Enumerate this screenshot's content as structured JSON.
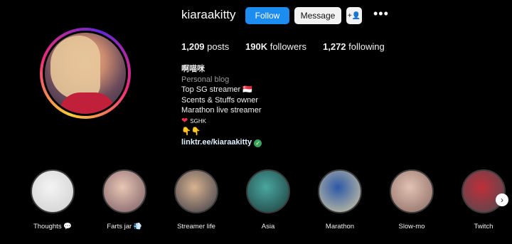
{
  "profile": {
    "username": "kiaraakitty",
    "follow_label": "Follow",
    "message_label": "Message",
    "add_user_glyph": "+👤",
    "more_glyph": "•••",
    "stats": {
      "posts_count": "1,209",
      "posts_label": "posts",
      "followers_count": "190K",
      "followers_label": "followers",
      "following_count": "1,272",
      "following_label": "following"
    },
    "bio": {
      "name": "啊喵咪",
      "category": "Personal blog",
      "line1": "Top SG streamer 🇸🇬",
      "line2": "Scents & Stuffs owner",
      "line3": "Marathon live streamer",
      "line4_emoji": "❤",
      "line4_text": "SGHK",
      "line5": "👇👇",
      "link": "linktr.ee/kiaraakitty"
    }
  },
  "highlights": [
    {
      "label": "Thoughts 💬",
      "color_a": "#f4f4f4",
      "color_b": "#cfcfcf"
    },
    {
      "label": "Farts jar 💨",
      "color_a": "#e8c7b4",
      "color_b": "#7a5b64"
    },
    {
      "label": "Streamer life",
      "color_a": "#d9b38f",
      "color_b": "#3a3a48"
    },
    {
      "label": "Asia",
      "color_a": "#4aa7a0",
      "color_b": "#1c3b3a"
    },
    {
      "label": "Marathon",
      "color_a": "#2c58a8",
      "color_b": "#d6cca2"
    },
    {
      "label": "Slow-mo",
      "color_a": "#e2c2b3",
      "color_b": "#8a6a60"
    },
    {
      "label": "Twitch",
      "color_a": "#bf2f3a",
      "color_b": "#4a4a50"
    }
  ],
  "next_arrow_glyph": "›"
}
